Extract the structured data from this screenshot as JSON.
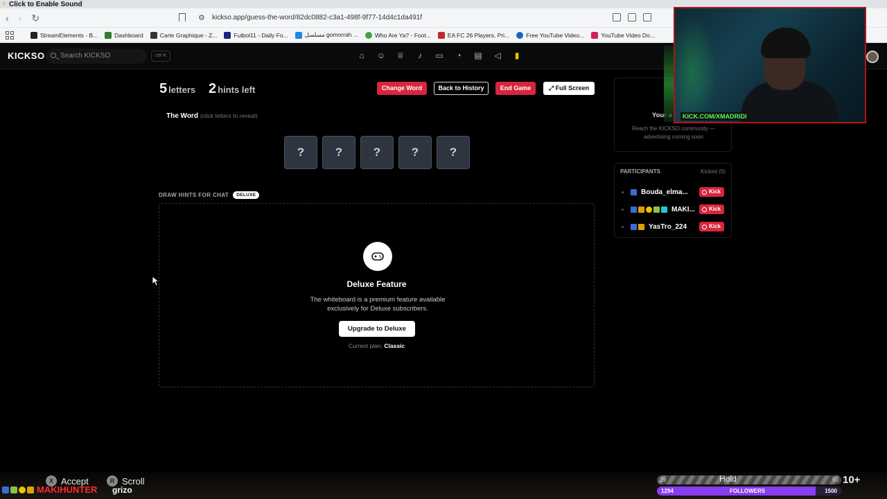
{
  "browser": {
    "sound_banner": "Click to Enable Sound",
    "url": "kickso.app/guess-the-word/82dc0882-c3a1-498f-9f77-14d4c1da491f",
    "bookmarks": [
      {
        "label": "StreamElements - B...",
        "color": "#222222"
      },
      {
        "label": "Dashboard",
        "color": "#2e7d32"
      },
      {
        "label": "Carte Graphique - Z...",
        "color": "#333333"
      },
      {
        "label": "Futbol11 - Daily Fo...",
        "color": "#1a237e"
      },
      {
        "label": "مسلسل gomorrah ...",
        "color": "#1e88e5"
      },
      {
        "label": "Who Are Ya? - Foot...",
        "color": "#43a047"
      },
      {
        "label": "EA FC 26 Players, Pri...",
        "color": "#c62828"
      },
      {
        "label": "Free YouTube Video...",
        "color": "#1565c0"
      },
      {
        "label": "YouTube Video Do...",
        "color": "#d81b60"
      }
    ]
  },
  "header": {
    "logo": "KICKSO",
    "search_placeholder": "Search KICKSO",
    "shortcut": "ctrl K",
    "nav_icons": [
      "home-icon",
      "users-icon",
      "trophy-icon",
      "mic-icon",
      "monitor-icon",
      "chart-icon",
      "news-icon",
      "megaphone-icon",
      "traffic-light-icon"
    ]
  },
  "game": {
    "letters_count": "5",
    "letters_label": "letters",
    "hints_count": "2",
    "hints_label": "hints left",
    "buttons": {
      "change_word": "Change Word",
      "back_history": "Back to History",
      "end_game": "End Game",
      "full_screen": "Full Screen"
    },
    "word_title": "The Word",
    "word_hint": "(click letters to reveal)",
    "tiles": [
      "?",
      "?",
      "?",
      "?",
      "?"
    ],
    "draw_label": "DRAW HINTS FOR CHAT",
    "draw_badge": "DELUXE",
    "whiteboard": {
      "title": "Deluxe Feature",
      "description": "The whiteboard is a premium feature available exclusively for Deluxe subscribers.",
      "upgrade": "Upgrade to Deluxe",
      "plan_label": "Current plan:",
      "plan_value": "Classic"
    }
  },
  "ad_panel": {
    "title": "Your a",
    "text": "Reach the KICKSO community — advertising coming soon"
  },
  "participants": {
    "title": "PARTICIPANTS",
    "kicked": "Kicked (0)",
    "kick_label": "Kick",
    "rows": [
      {
        "name": "Bouda_elma..."
      },
      {
        "name": "MAKI..."
      },
      {
        "name": "YasTro_224"
      }
    ]
  },
  "stream_overlay": {
    "cam_tag": "KICK.COM/XMADRIDI",
    "accept": "Accept",
    "scroll": "Scroll",
    "accept_key": "X",
    "scroll_key": "R",
    "hunter_name": "MAKIHUNTER",
    "hunter_sub": "grizo",
    "goal_left": "29",
    "hold_text": "Hold",
    "goal_right": "50",
    "followers_current": "1294",
    "followers_label": "FOLLOWERS",
    "followers_goal": "1500",
    "followers_progress": 0.8627,
    "plus_text": "10+"
  }
}
